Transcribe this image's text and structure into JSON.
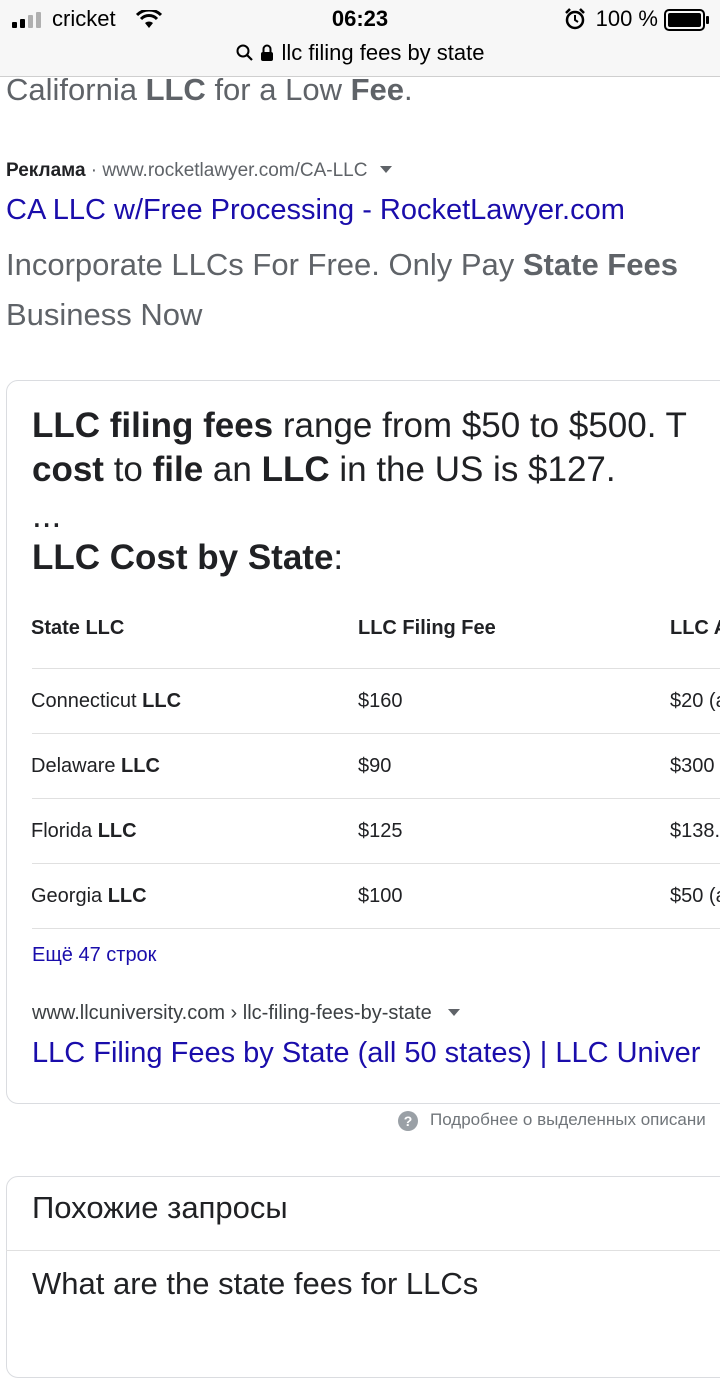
{
  "status_bar": {
    "carrier": "cricket",
    "time": "06:23",
    "battery": "100 %"
  },
  "url_bar": {
    "query": "llc filing fees by state"
  },
  "top_line": {
    "a": "California ",
    "b": "LLC",
    "c": " for a Low ",
    "d": "Fee",
    "e": "."
  },
  "ad": {
    "label": "Реклама",
    "separator": " · ",
    "url": "www.rocketlawyer.com/CA-LLC",
    "title": "CA LLC w/Free Processing - RocketLawyer.com",
    "desc_line1_a": "Incorporate LLCs For Free. Only Pay ",
    "desc_line1_b": "State Fees",
    "desc_line2": "Business Now"
  },
  "snippet": {
    "line1_b1": "LLC filing fees",
    "line1_t1": " range from $50 to $500. T",
    "line2_b1": "cost",
    "line2_t1": " to ",
    "line2_b2": "file",
    "line2_t2": " an ",
    "line2_b3": "LLC",
    "line2_t3": " in the US is $127.",
    "ellipsis": "...",
    "heading": "LLC Cost by State",
    "heading_colon": ":"
  },
  "table": {
    "headers": [
      "State LLC",
      "LLC Filing Fee",
      "LLC A"
    ],
    "rows": [
      {
        "state": "Connecticut ",
        "suffix": "LLC",
        "fee": "$160",
        "annual": "$20 (a"
      },
      {
        "state": "Delaware ",
        "suffix": "LLC",
        "fee": "$90",
        "annual": "$300"
      },
      {
        "state": "Florida ",
        "suffix": "LLC",
        "fee": "$125",
        "annual": "$138."
      },
      {
        "state": "Georgia ",
        "suffix": "LLC",
        "fee": "$100",
        "annual": "$50 (a"
      }
    ],
    "more_rows": "Ещё 47 строк"
  },
  "result": {
    "cite": "www.llcuniversity.com › llc-filing-fees-by-state",
    "title": "LLC Filing Fees by State (all 50 states) | LLC Univer"
  },
  "about_snippets": "Подробнее о выделенных описани",
  "related": {
    "title": "Похожие запросы",
    "first_item": "What are the state fees for LLCs"
  },
  "colors": {
    "link": "#1a0dab",
    "text": "#202124",
    "secondary": "#5f6368"
  }
}
